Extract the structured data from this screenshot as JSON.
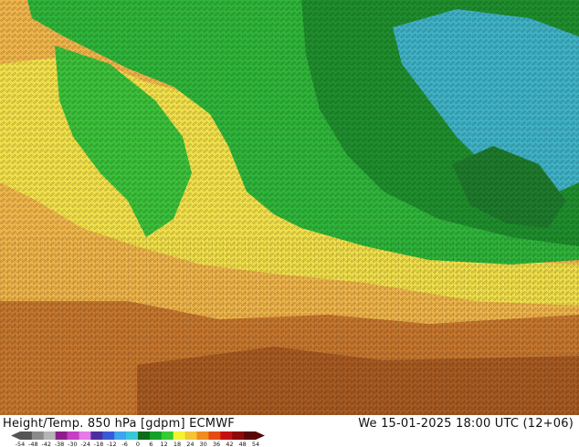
{
  "title": "Height/Temp. 850 hPa [gdpm] ECMWF",
  "validity": "We 15-01-2025 18:00 UTC (12+06)",
  "legend": {
    "ticks": [
      "-54",
      "-48",
      "-42",
      "-38",
      "-30",
      "-24",
      "-18",
      "-12",
      "-6",
      "0",
      "6",
      "12",
      "18",
      "24",
      "30",
      "36",
      "42",
      "48",
      "54"
    ],
    "colors": [
      "#555555",
      "#8a8a8a",
      "#b4b4b4",
      "#8c1f8c",
      "#c440c4",
      "#e67ae6",
      "#4b2fa0",
      "#3b59d6",
      "#3fa3ef",
      "#37c7d8",
      "#0d6b1a",
      "#14a02a",
      "#33cc33",
      "#f2f230",
      "#f5c432",
      "#f08b1e",
      "#e64a12",
      "#c41010",
      "#8a0a0a",
      "#5a0606"
    ]
  }
}
